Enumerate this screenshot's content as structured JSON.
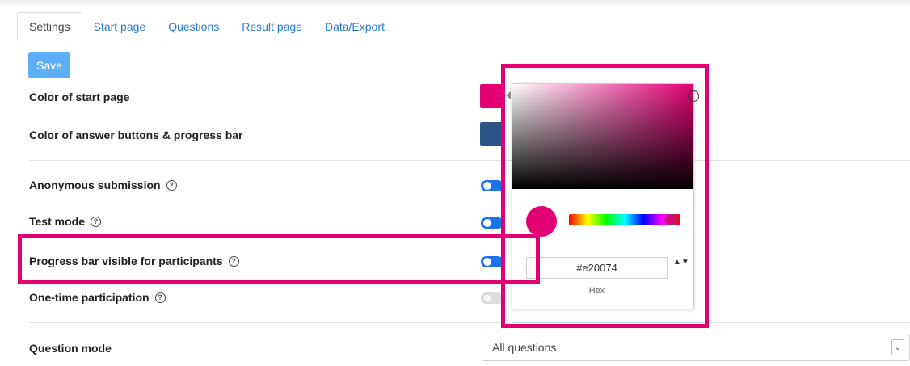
{
  "tabs": [
    {
      "label": "Settings",
      "active": true
    },
    {
      "label": "Start page",
      "active": false
    },
    {
      "label": "Questions",
      "active": false
    },
    {
      "label": "Result page",
      "active": false
    },
    {
      "label": "Data/Export",
      "active": false
    }
  ],
  "toolbar": {
    "save_label": "Save"
  },
  "settings": {
    "start_color_label": "Color of start page",
    "start_color_value": "#e20074",
    "button_color_label": "Color of answer buttons & progress bar",
    "button_color_value": "#2c5585",
    "anonymous_label": "Anonymous submission",
    "anonymous_on": true,
    "test_mode_label": "Test mode",
    "test_mode_on": true,
    "progress_visible_label": "Progress bar visible for participants",
    "progress_visible_on": true,
    "one_time_label": "One-time participation",
    "one_time_on": false,
    "question_mode_label": "Question mode",
    "question_mode_value": "All questions"
  },
  "help_icon": "question-circle-icon",
  "color_picker": {
    "hex_value": "#e20074",
    "mode_label": "Hex",
    "spinner_glyph": "▲▼"
  },
  "colors": {
    "accent": "#e20074",
    "link": "#2a7bd6",
    "toggle_on": "#1a73e8",
    "save_button": "#5eaef6"
  }
}
